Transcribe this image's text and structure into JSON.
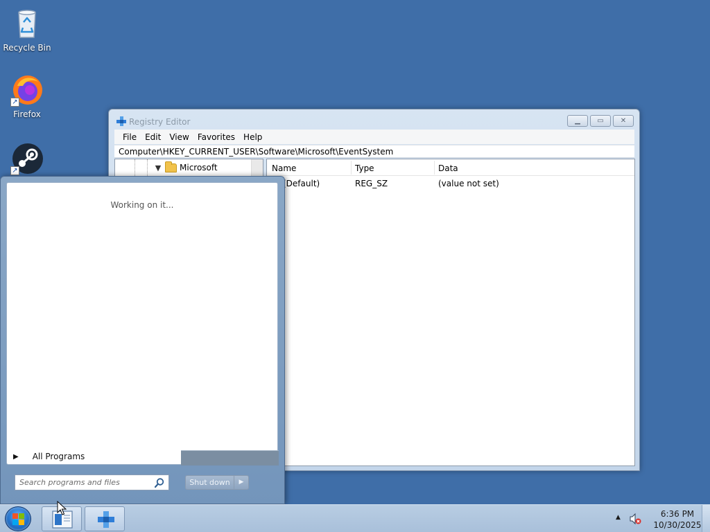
{
  "desktop": {
    "icons": [
      {
        "label": "Recycle Bin",
        "icon": "recycle-bin-icon"
      },
      {
        "label": "Firefox",
        "icon": "firefox-icon"
      },
      {
        "label": "Steam",
        "icon": "steam-icon"
      }
    ]
  },
  "regedit": {
    "title": "Registry Editor",
    "menu": [
      "File",
      "Edit",
      "View",
      "Favorites",
      "Help"
    ],
    "address": "Computer\\HKEY_CURRENT_USER\\Software\\Microsoft\\EventSystem",
    "tree": {
      "node": "Microsoft",
      "expanded": true
    },
    "columns": [
      "Name",
      "Type",
      "Data"
    ],
    "rows": [
      {
        "name": "(Default)",
        "type": "REG_SZ",
        "data": "(value not set)"
      }
    ]
  },
  "start_menu": {
    "status": "Working on it...",
    "all_programs": "All Programs",
    "search_placeholder": "Search programs and files",
    "shutdown": "Shut down"
  },
  "taskbar": {
    "pinned": [
      "file-explorer-icon",
      "registry-editor-icon"
    ],
    "clock": {
      "time": "6:36 PM",
      "date": "10/30/2025"
    },
    "tray_icons": [
      "show-hidden-icons-icon",
      "volume-muted-icon"
    ]
  },
  "colors": {
    "desktop_bg": "#3f6ea8",
    "taskbar": "#b8cde3",
    "start_menu_frame": "#8aa7c6"
  }
}
